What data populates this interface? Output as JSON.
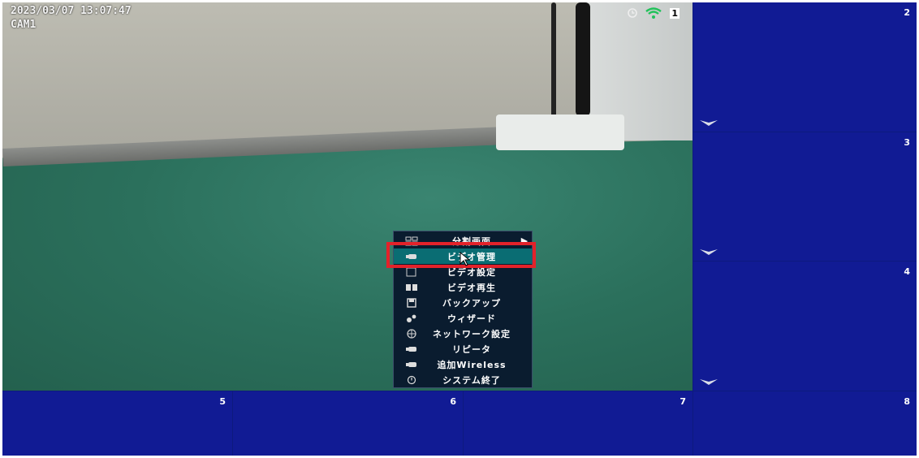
{
  "osd": {
    "timestamp": "2023/03/07 13:07:47",
    "camera_name": "CAM1",
    "channel_number": "1"
  },
  "panes": [
    {
      "number": "2"
    },
    {
      "number": "3"
    },
    {
      "number": "4"
    },
    {
      "number": "5"
    },
    {
      "number": "6"
    },
    {
      "number": "7"
    },
    {
      "number": "8"
    }
  ],
  "menu": {
    "items": [
      {
        "label": "分割画面",
        "icon": "grid-icon",
        "has_submenu": true
      },
      {
        "label": "ビデオ管理",
        "icon": "camera-icon",
        "active": true
      },
      {
        "label": "ビデオ設定",
        "icon": "settings-icon"
      },
      {
        "label": "ビデオ再生",
        "icon": "playback-icon"
      },
      {
        "label": "バックアップ",
        "icon": "save-icon"
      },
      {
        "label": "ウィザード",
        "icon": "gears-icon"
      },
      {
        "label": "ネットワーク設定",
        "icon": "globe-icon"
      },
      {
        "label": "リピータ",
        "icon": "camera-icon"
      },
      {
        "label": "追加Wireless",
        "icon": "camera-icon"
      },
      {
        "label": "システム終了",
        "icon": "power-icon"
      }
    ],
    "submenu_arrow": "▶"
  },
  "colors": {
    "pane_bg": "#111b94",
    "menu_bg": "#0a1c2f",
    "menu_active": "#0a6d73",
    "highlight": "#e3222a"
  }
}
